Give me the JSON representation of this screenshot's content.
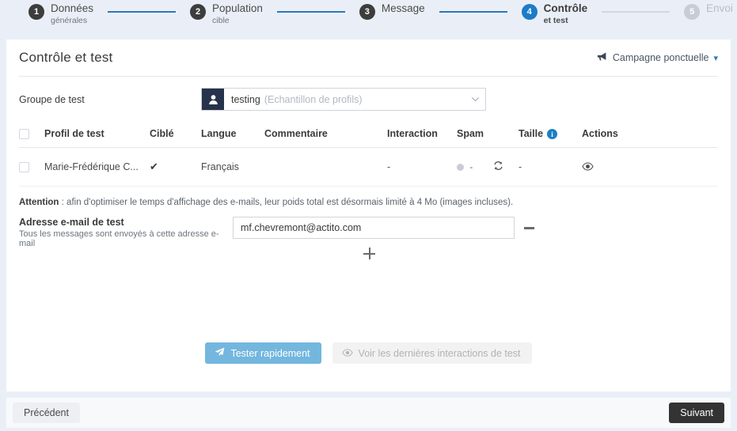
{
  "stepper": {
    "steps": [
      {
        "num": "1",
        "title": "Données",
        "sub": "générales",
        "state": "done"
      },
      {
        "num": "2",
        "title": "Population",
        "sub": "cible",
        "state": "done"
      },
      {
        "num": "3",
        "title": "Message",
        "sub": "",
        "state": "done"
      },
      {
        "num": "4",
        "title": "Contrôle",
        "sub": "et test",
        "state": "current"
      },
      {
        "num": "5",
        "title": "Envoi",
        "sub": "",
        "state": "disabled"
      }
    ]
  },
  "header": {
    "title": "Contrôle et test",
    "campaign_label": "Campagne ponctuelle",
    "campaign_icon": "megaphone-icon",
    "campaign_caret": "chevron-down-icon"
  },
  "test_group": {
    "label": "Groupe de test",
    "avatar_icon": "user-icon",
    "value": "testing",
    "hint": "(Echantillon de profils)",
    "caret": "chevron-down-icon"
  },
  "table": {
    "columns": [
      "Profil de test",
      "Ciblé",
      "Langue",
      "Commentaire",
      "Interaction",
      "Spam",
      "Taille",
      "Actions"
    ],
    "taille_info_icon": "info-icon",
    "rows": [
      {
        "profil": "Marie-Frédérique C...",
        "cible": "✔",
        "langue": "Français",
        "commentaire": "",
        "interaction": "-",
        "spam_dot": "•",
        "spam_value": "-",
        "spam_refresh_icon": "refresh-icon",
        "taille": "-",
        "actions_icon": "eye-icon"
      }
    ]
  },
  "notice": {
    "strong": "Attention",
    "text": " : afin d'optimiser le temps d'affichage des e-mails, leur poids total est désormais limité à 4 Mo (images incluses)."
  },
  "email": {
    "label": "Adresse e-mail de test",
    "sublabel": "Tous les messages sont envoyés à cette adresse e-mail",
    "value": "mf.chevremont@actito.com",
    "placeholder": "",
    "remove_icon": "minus-icon",
    "add_icon": "plus-icon"
  },
  "actions": {
    "test_label": "Tester rapidement",
    "test_icon": "paper-plane-icon",
    "view_label": "Voir les dernières interactions de test",
    "view_icon": "eye-icon"
  },
  "footer": {
    "prev_label": "Précédent",
    "next_label": "Suivant"
  },
  "colors": {
    "accent_blue": "#1c7cc7",
    "connector_blue": "#2b79b5",
    "page_bg": "#eaeff7",
    "button_light_blue": "#73b6de",
    "next_dark": "#333333",
    "avatar_navy": "#27334a"
  }
}
